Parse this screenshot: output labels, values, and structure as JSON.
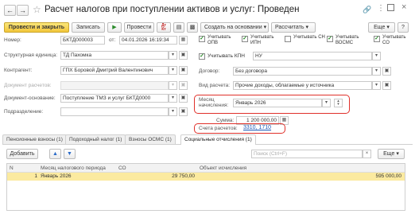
{
  "title": "Расчет налогов при поступлении активов и услуг: Проведен",
  "toolbar": {
    "post_close": "Провести и закрыть",
    "save": "Записать",
    "post": "Провести",
    "dt_kt": "Дт\nКт",
    "create_based": "Создать на основании",
    "calculate": "Рассчитать",
    "more": "Еще"
  },
  "form": {
    "number_label": "Номер:",
    "number_value": "БКТД000003",
    "date_label": "от:",
    "date_value": "04.01.2026 16:19:34",
    "struct_label": "Структурная единица:",
    "struct_value": "ТД Пахомка",
    "counterparty_label": "Контрагент:",
    "counterparty_value": "ГПХ Боровой Дмитрий Валентинович",
    "calc_doc_label": "Документ расчетов:",
    "basis_label": "Документ-основание:",
    "basis_value": "Поступление ТМЗ и услуг БКТД0000",
    "division_label": "Подразделение:",
    "checks": [
      {
        "label": "Учитывать ОПВ",
        "checked": true
      },
      {
        "label": "Учитывать ИПН",
        "checked": true
      },
      {
        "label": "Учитывать СН",
        "checked": false
      },
      {
        "label": "Учитывать ВОСМС",
        "checked": true
      },
      {
        "label": "Учитывать СО",
        "checked": true
      }
    ],
    "kpn_label": "Учитывать КПН",
    "kpn_value": "НУ",
    "contract_label": "Договор:",
    "contract_value": "Без договора",
    "income_label": "Вид расчета:",
    "income_value": "Прочие доходы, облагаемые у источника",
    "month_label": "Месяц начисления:",
    "month_value": "Январь 2026",
    "sum_label": "Сумма:",
    "sum_value": "1 200 000,00",
    "accounts_label": "Счета расчетов:",
    "accounts_value": "3310, 1710"
  },
  "tabs": [
    {
      "label": "Пенсионные взносы (1)",
      "active": false
    },
    {
      "label": "Подоходный налог (1)",
      "active": false
    },
    {
      "label": "Взносы ОСМС (1)",
      "active": false
    },
    {
      "label": "Социальные отчисления (1)",
      "active": true
    }
  ],
  "table": {
    "add_label": "Добавить",
    "search_placeholder": "Поиск (Ctrl+F)",
    "more": "Еще",
    "columns": [
      "N",
      "Месяц налогового периода",
      "СО",
      "Объект исчисления"
    ],
    "rows": [
      {
        "n": "1",
        "month": "Январь 2026",
        "so": "29 750,00",
        "object": "595 000,00"
      }
    ]
  }
}
